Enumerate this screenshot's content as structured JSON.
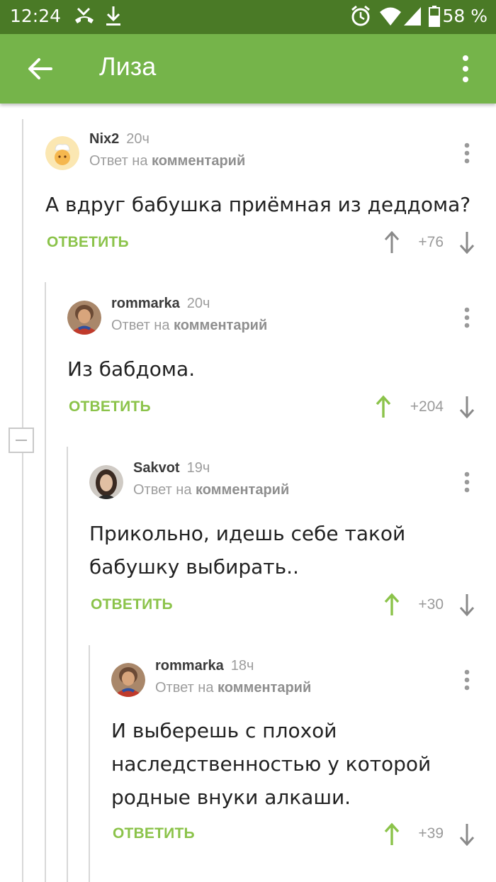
{
  "status_bar": {
    "time": "12:24",
    "battery": "58 %",
    "icons": [
      "missed-call-icon",
      "download-icon",
      "alarm-icon",
      "wifi-icon",
      "signal-icon",
      "battery-icon"
    ]
  },
  "app_bar": {
    "title": "Лиза",
    "back_icon": "arrow-back-icon",
    "more_icon": "more-vert-icon",
    "color": "#75b44a"
  },
  "comments": [
    {
      "author": "Nix2",
      "time": "20ч",
      "reply_prefix": "Ответ на",
      "reply_target": "комментарий",
      "text_lines": [
        "А вдруг бабушка приёмная из деддома?"
      ],
      "reply_label": "ОТВЕТИТЬ",
      "rating": "+76",
      "upvoted": false
    },
    {
      "author": "rommarka",
      "time": "20ч",
      "reply_prefix": "Ответ на",
      "reply_target": "комментарий",
      "text_lines": [
        "Из бабдома."
      ],
      "reply_label": "ОТВЕТИТЬ",
      "rating": "+204",
      "upvoted": true
    },
    {
      "author": "Sakvot",
      "time": "19ч",
      "reply_prefix": "Ответ на",
      "reply_target": "комментарий",
      "text_lines": [
        "Прикольно, идешь себе такой",
        "бабушку выбирать.."
      ],
      "reply_label": "ОТВЕТИТЬ",
      "rating": "+30",
      "upvoted": true
    },
    {
      "author": "rommarka",
      "time": "18ч",
      "reply_prefix": "Ответ на",
      "reply_target": "комментарий",
      "text_lines": [
        "И выберешь с плохой",
        "наследственностью у которой",
        "родные внуки алкаши."
      ],
      "reply_label": "ОТВЕТИТЬ",
      "rating": "+39",
      "upvoted": true
    }
  ],
  "colors": {
    "accent_green": "#8bc34a",
    "status_bar": "#4a7a26",
    "vote_active": "#8bc34a",
    "vote_inactive": "#8a8a8a"
  }
}
